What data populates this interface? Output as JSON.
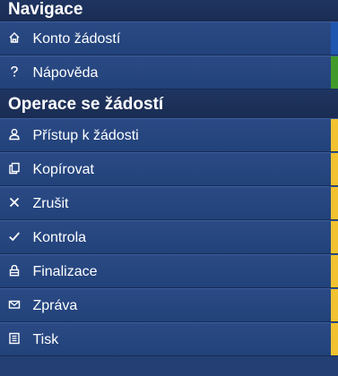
{
  "navigation": {
    "header": "Navigace",
    "items": [
      {
        "label": "Konto žádostí",
        "icon": "home-icon",
        "accent": "#1f56b0"
      },
      {
        "label": "Nápověda",
        "icon": "help-icon",
        "accent": "#3f9a2a"
      }
    ]
  },
  "operations": {
    "header": "Operace se žádostí",
    "accent": "#f2c230",
    "items": [
      {
        "label": "Přístup k žádosti",
        "icon": "user-icon"
      },
      {
        "label": "Kopírovat",
        "icon": "copy-icon"
      },
      {
        "label": "Zrušit",
        "icon": "close-icon"
      },
      {
        "label": "Kontrola",
        "icon": "check-icon"
      },
      {
        "label": "Finalizace",
        "icon": "lock-icon"
      },
      {
        "label": "Zpráva",
        "icon": "envelope-icon"
      },
      {
        "label": "Tisk",
        "icon": "print-icon"
      }
    ]
  }
}
